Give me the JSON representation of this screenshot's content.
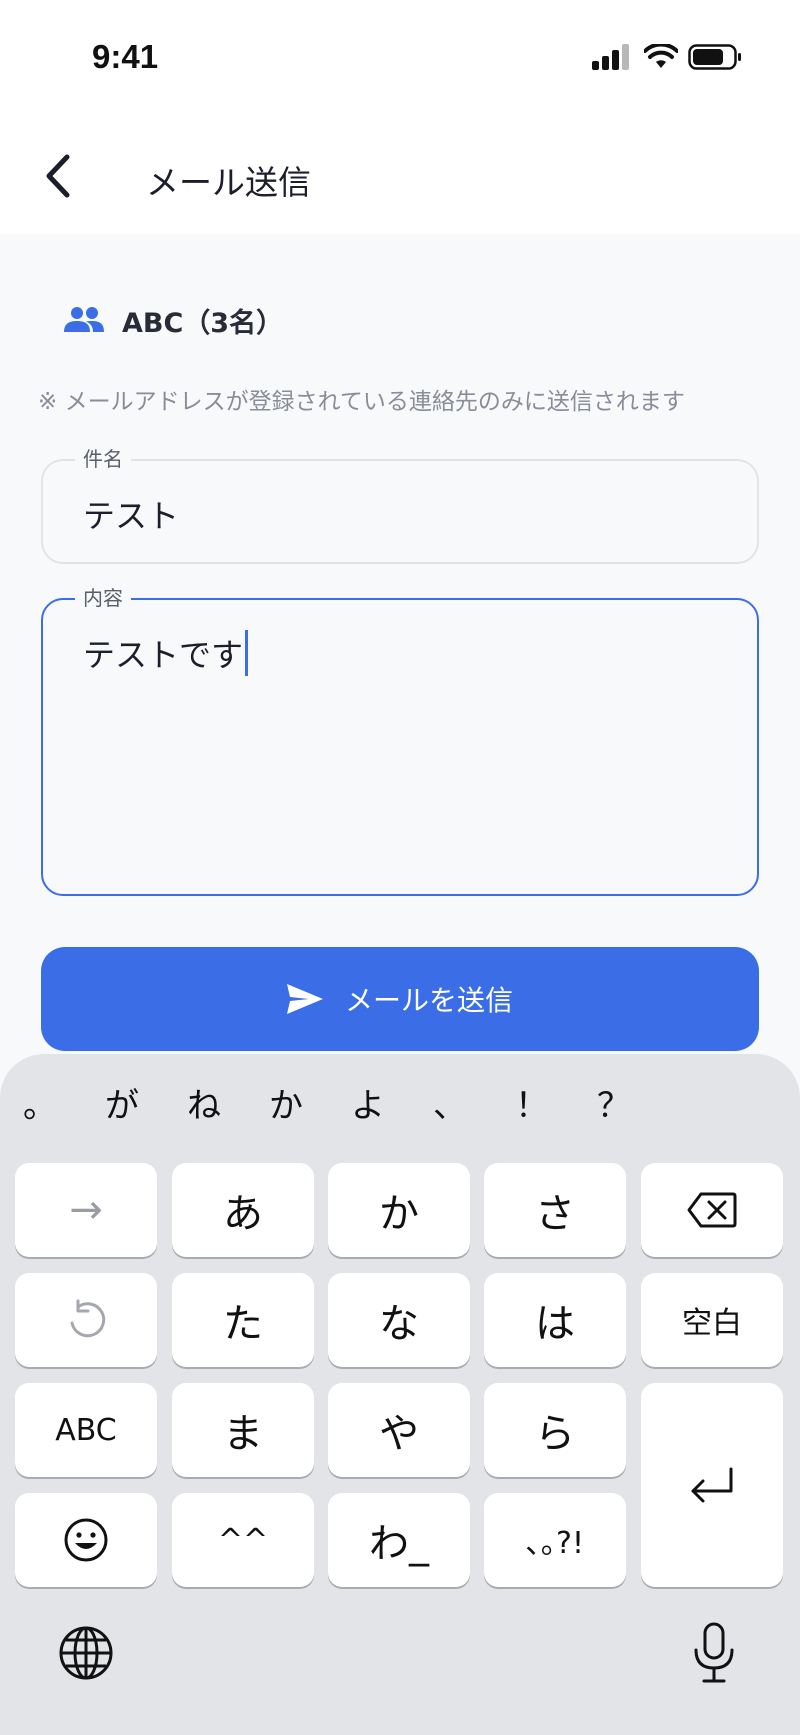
{
  "status_bar": {
    "time": "9:41"
  },
  "header": {
    "title": "メール送信"
  },
  "recipient": {
    "label": "ABC（3名）"
  },
  "notice": "※ メールアドレスが登録されている連絡先のみに送信されます",
  "subject": {
    "legend": "件名",
    "value": "テスト"
  },
  "content": {
    "legend": "内容",
    "value": "テストです"
  },
  "send_button": {
    "label": "メールを送信"
  },
  "colors": {
    "accent": "#3a6de6",
    "background": "#f7f9fb",
    "keyboard": "#e2e4e8"
  },
  "keyboard": {
    "suggestions": [
      "。",
      "が",
      "ね",
      "か",
      "よ",
      "、",
      "！",
      "？"
    ],
    "row1": {
      "next": "→",
      "k1": "あ",
      "k2": "か",
      "k3": "さ",
      "delete": "delete-icon"
    },
    "row2": {
      "undo": "undo-icon",
      "k1": "た",
      "k2": "な",
      "k3": "は",
      "space": "空白"
    },
    "row3": {
      "abc": "ABC",
      "k1": "ま",
      "k2": "や",
      "k3": "ら",
      "return": "return-icon"
    },
    "row4": {
      "emoji": "emoji-icon",
      "k1": "^^",
      "k2": "わ_",
      "k3": "､｡?!"
    },
    "bottom": {
      "globe": "globe-icon",
      "mic": "microphone-icon"
    }
  }
}
